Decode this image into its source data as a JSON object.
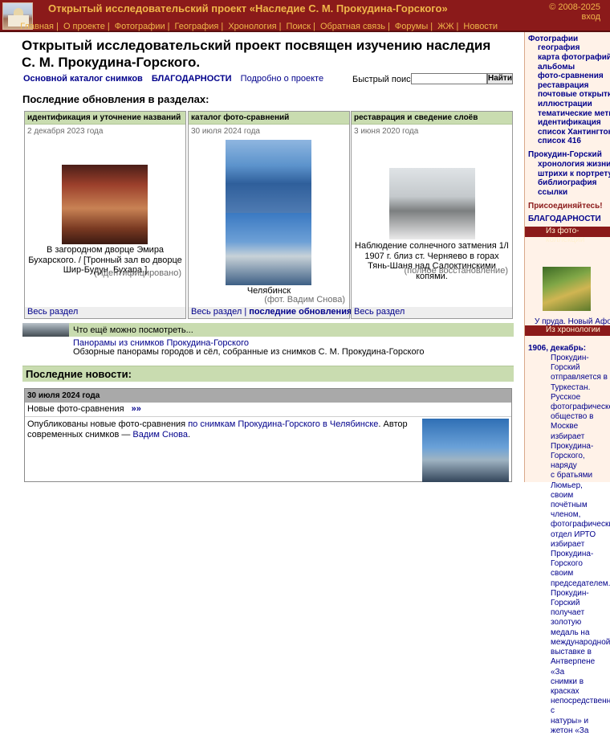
{
  "header": {
    "title": "Открытый исследовательский проект «Наследие С. М. Прокудина-Горского»",
    "copyright": "© 2008-2025",
    "login": "вход",
    "nav": [
      "Главная",
      "О проекте",
      "Фотографии",
      "География",
      "Хронология",
      "Поиск",
      "Обратная связь",
      "Форумы",
      "ЖЖ",
      "Новости"
    ]
  },
  "main": {
    "headline_line1": "Открытый исследовательский проект посвящен изучению наследия",
    "headline_line2": "С. М. Прокудина-Горского.",
    "links": {
      "catalog": "Основной каталог снимков",
      "thanks": "БЛАГОДАРНОСТИ",
      "about": "Подробно о проекте"
    },
    "search": {
      "label": "Быстрый поиск:",
      "value": "",
      "button": "Найти"
    },
    "updates_title": "Последние обновления в разделах:",
    "cards": [
      {
        "head": "идентификация и уточнение названий",
        "date": "2 декабря 2023 года",
        "caption": "В загородном дворце Эмира Бухарского. / [Тронный зал во дворце Шир-Будун. Бухара.]",
        "note": "(Идентифицировано)",
        "foot": "Весь раздел",
        "foot2": ""
      },
      {
        "head": "каталог фото-сравнений",
        "date": "30 июля 2024 года",
        "caption": "Челябинск",
        "note": "(фот. Вадим Снова)",
        "foot": "Весь раздел",
        "foot2": "последние обновления"
      },
      {
        "head": "реставрация и сведение слоёв",
        "date": "3 июня 2020 года",
        "caption": "Наблюдение солнечного затмения 1/I 1907 г. близ ст. Черняево в горах Тянь-Шаня над Салоктинскими копями.",
        "note": "(полное восстановление)",
        "foot": "Весь раздел",
        "foot2": ""
      }
    ],
    "also": {
      "title": "Что ещё можно посмотреть...",
      "link": "Панорамы из снимков Прокудина-Горского",
      "desc": "Обзорные панорамы городов и сёл, собранные из снимков С. М. Прокудина-Горского"
    },
    "news": {
      "title": "Последние новости:",
      "date": "30 июля 2024 года",
      "subtitle": "Новые фото-сравнения",
      "more": "»»",
      "text_before": "Опубликованы новые фото-сравнения ",
      "text_link1": "по снимкам Прокудина-Горского в Челябинске",
      "text_mid": ". Автор современных снимков — ",
      "text_link2": "Вадим Снова",
      "text_end": "."
    }
  },
  "sidebar": {
    "photos_head": "Фотографии",
    "photo_links": [
      "география",
      "карта фотографий",
      "альбомы",
      "фото-сравнения",
      "реставрация",
      "почтовые открытки",
      "иллюстрации",
      "тематические метки",
      "идентификация",
      "список Хантингтона",
      "список 416"
    ],
    "pg_head": "Прокудин-Горский",
    "pg_links": [
      "хронология жизни",
      "штрихи к портрету",
      "библиография",
      "ссылки"
    ],
    "join": "Присоединяйтесь!",
    "thanks": "БЛАГОДАРНОСТИ",
    "collection_head": "Из фото-коллекции",
    "collection_caption": "У пруда. Новый Афон.",
    "chronology_head": "Из хронологии",
    "chron_date": "1906, декабрь:",
    "chron_lines": [
      "Прокудин-Горский",
      "отправляется в",
      "Туркестан. Русское",
      "фотографическое",
      "общество в Москве",
      "избирает Прокудина-",
      "Горского, наряду",
      "с братьями Люмьер,",
      "своим почётным",
      "членом,",
      "фотографический",
      "отдел ИРТО избирает",
      "Прокудина-Горского",
      "своим",
      "председателем.",
      "Прокудин-Горский",
      "получает золотую",
      "медаль на",
      "международной",
      "выставке в",
      "Антверпене «За",
      "снимки в красках",
      "непосредственно с",
      "натуры» и жетон «За"
    ]
  }
}
